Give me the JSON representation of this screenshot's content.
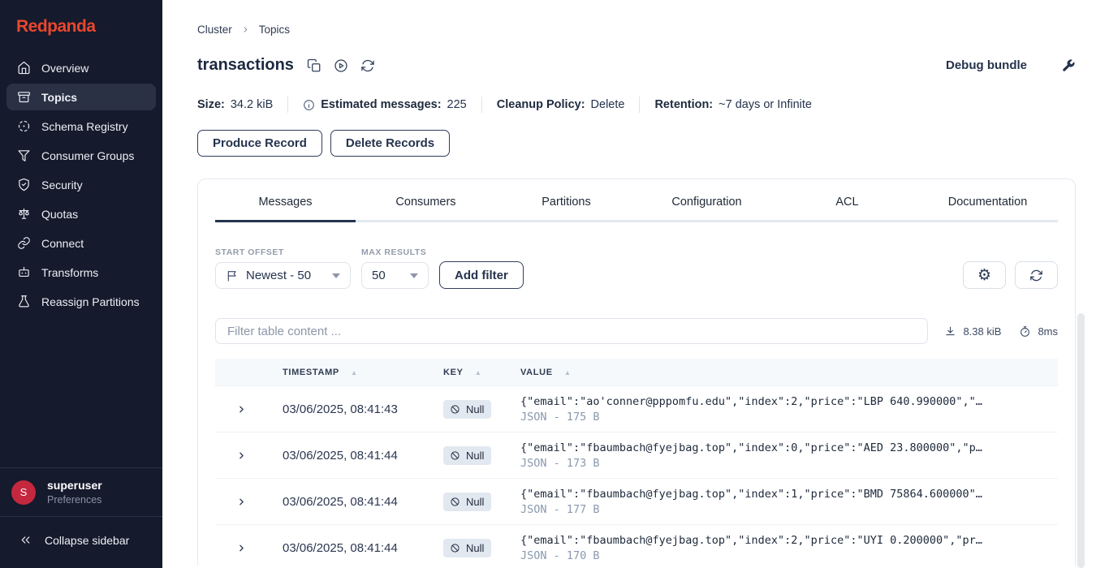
{
  "colors": {
    "accent": "#E9472E",
    "sidebar_bg": "#151A2C",
    "navy": "#25334D",
    "avatar_red": "#C5283E",
    "active_item_bg": "#2A3145",
    "badge_bg": "#E2E8F0"
  },
  "sidebar": {
    "logo_text": "Redpanda",
    "items": [
      {
        "label": "Overview",
        "icon": "home-icon",
        "active": false
      },
      {
        "label": "Topics",
        "icon": "topics-icon",
        "active": true
      },
      {
        "label": "Schema Registry",
        "icon": "schema-registry-icon",
        "active": false
      },
      {
        "label": "Consumer Groups",
        "icon": "consumer-groups-icon",
        "active": false
      },
      {
        "label": "Security",
        "icon": "security-icon",
        "active": false
      },
      {
        "label": "Quotas",
        "icon": "quotas-icon",
        "active": false
      },
      {
        "label": "Connect",
        "icon": "connect-icon",
        "active": false
      },
      {
        "label": "Transforms",
        "icon": "transforms-icon",
        "active": false
      },
      {
        "label": "Reassign Partitions",
        "icon": "reassign-partitions-icon",
        "active": false
      }
    ],
    "user": {
      "avatar_initial": "S",
      "name": "superuser",
      "preferences_label": "Preferences"
    },
    "collapse_label": "Collapse sidebar"
  },
  "breadcrumb": {
    "cluster": "Cluster",
    "topics": "Topics"
  },
  "page": {
    "title": "transactions",
    "debug_bundle_label": "Debug bundle"
  },
  "stats": {
    "size_label": "Size:",
    "size_value": "34.2 kiB",
    "messages_label": "Estimated messages:",
    "messages_value": "225",
    "cleanup_label": "Cleanup Policy:",
    "cleanup_value": "Delete",
    "retention_label": "Retention:",
    "retention_value": "~7 days or Infinite"
  },
  "actions": {
    "produce_record": "Produce Record",
    "delete_records": "Delete Records"
  },
  "tabs": {
    "active": "Messages",
    "items": [
      {
        "label": "Messages"
      },
      {
        "label": "Consumers"
      },
      {
        "label": "Partitions"
      },
      {
        "label": "Configuration"
      },
      {
        "label": "ACL"
      },
      {
        "label": "Documentation"
      }
    ]
  },
  "controls": {
    "start_offset_label": "START OFFSET",
    "start_offset_value": "Newest - 50",
    "max_results_label": "MAX RESULTS",
    "max_results_value": "50",
    "add_filter_label": "Add filter"
  },
  "filter_bar": {
    "placeholder": "Filter table content ...",
    "payload_size": "8.38 kiB",
    "elapsed": "8ms"
  },
  "messages_table": {
    "headers": {
      "timestamp": "TIMESTAMP",
      "key": "KEY",
      "value": "VALUE"
    },
    "rows": [
      {
        "timestamp": "03/06/2025, 08:41:43",
        "key": "Null",
        "value": "{\"email\":\"ao'conner@pppomfu.edu\",\"index\":2,\"price\":\"LBP 640.990000\",\"…",
        "meta": "JSON - 175 B"
      },
      {
        "timestamp": "03/06/2025, 08:41:44",
        "key": "Null",
        "value": "{\"email\":\"fbaumbach@fyejbag.top\",\"index\":0,\"price\":\"AED 23.800000\",\"p…",
        "meta": "JSON - 173 B"
      },
      {
        "timestamp": "03/06/2025, 08:41:44",
        "key": "Null",
        "value": "{\"email\":\"fbaumbach@fyejbag.top\",\"index\":1,\"price\":\"BMD 75864.600000\"…",
        "meta": "JSON - 177 B"
      },
      {
        "timestamp": "03/06/2025, 08:41:44",
        "key": "Null",
        "value": "{\"email\":\"fbaumbach@fyejbag.top\",\"index\":2,\"price\":\"UYI 0.200000\",\"pr…",
        "meta": "JSON - 170 B"
      }
    ]
  }
}
